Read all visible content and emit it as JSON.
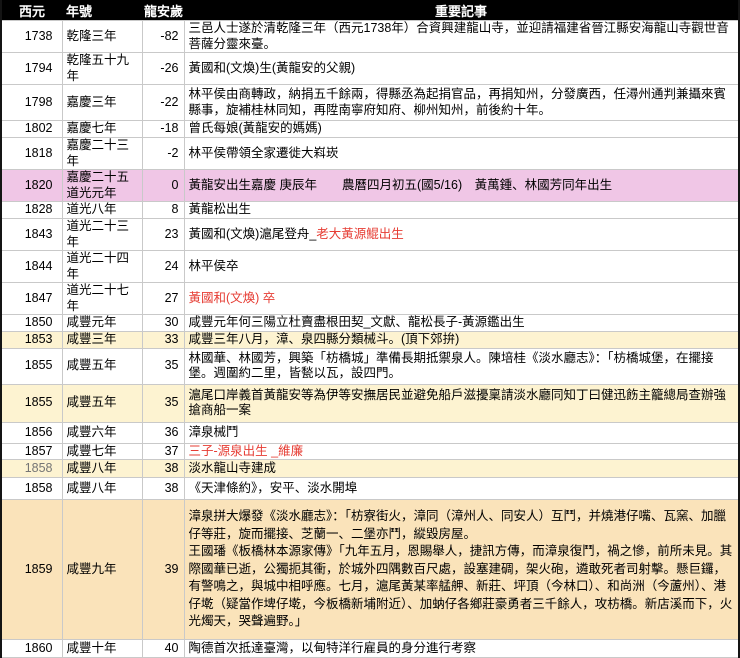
{
  "colors": {
    "header_bg": "#000000",
    "pink": "#f0c6e6",
    "yellow": "#fdf3d1",
    "tan": "#fae3ba",
    "red": "#e63c33"
  },
  "header": {
    "year": "西元",
    "era": "年號",
    "age": "龍安歲",
    "record": "重要記事"
  },
  "rows": [
    {
      "year": "1738",
      "era": "乾隆三年",
      "age": "-82",
      "record": "三邑人士遂於清乾隆三年（西元1738年）合資興建龍山寺，並迎請福建省晉江縣安海龍山寺觀世音菩薩分靈來臺。"
    },
    {
      "year": "1794",
      "era": "乾隆五十九年",
      "age": "-26",
      "record": "黃國和(文煥)生(黃龍安的父親)"
    },
    {
      "year": "1798",
      "era": "嘉慶三年",
      "age": "-22",
      "record": "林平侯由商轉政，納捐五千餘兩，得縣丞為起捐官品，再捐知州，分發廣西，任潯州通判兼攝來賓縣事，旋補桂林同知，再陞南寧府知府、柳州知州，前後約十年。"
    },
    {
      "year": "1802",
      "era": "嘉慶七年",
      "age": "-18",
      "record": "曾氏每娘(黃龍安的媽媽)"
    },
    {
      "year": "1818",
      "era": "嘉慶二十三年",
      "age": "-2",
      "record": "林平侯帶領全家遷徙大嵙崁"
    },
    {
      "year": "1820",
      "era": "嘉慶二十五",
      "era2": "道光元年",
      "age": "0",
      "record": "黃龍安出生嘉慶 庚辰年　　農曆四月初五(國5/16)　黃萬鍾、林國芳同年出生"
    },
    {
      "year": "1828",
      "era": "道光八年",
      "age": "8",
      "record": "黃龍松出生"
    },
    {
      "year": "1843",
      "era": "道光二十三年",
      "age": "23",
      "record": "黃國和(文煥)滬尾登舟_",
      "record_red": "老大黃源鯤出生"
    },
    {
      "year": "1844",
      "era": "道光二十四年",
      "age": "24",
      "record": "林平侯卒"
    },
    {
      "year": "1847",
      "era": "道光二十七年",
      "age": "27",
      "record": "黃國和(文煥) 卒"
    },
    {
      "year": "1850",
      "era": "咸豐元年",
      "age": "30",
      "record": "咸豐元年何三陽立杜賣盡根田契_文獻、龍松長子-黃源鑑出生"
    },
    {
      "year": "1853",
      "era": "咸豐三年",
      "age": "33",
      "record": "咸豐三年八月，漳、泉四縣分類械斗。(頂下郊拚)"
    },
    {
      "year": "1855",
      "era": "咸豐五年",
      "age": "35",
      "record": "林國華、林國芳，興築「枋橋城」準備長期抵禦泉人。陳培桂《淡水廳志》：「枋橋城堡，在擺接堡。週圍約二里，皆甃以瓦，設四門。"
    },
    {
      "year": "1855",
      "era": "咸豐五年",
      "age": "35",
      "record": "滬尾口岸義首黃龍安等為伊等安撫居民並避免船戶滋擾稟請淡水廳同知丁曰健迅飭主籠總局查辦強搶商船一案"
    },
    {
      "year": "1856",
      "era": "咸豐六年",
      "age": "36",
      "record": "漳泉械鬥"
    },
    {
      "year": "1857",
      "era": "咸豐七年",
      "age": "37",
      "record": "三子-源泉出生 _維廉"
    },
    {
      "year": "1858",
      "era": "咸豐八年",
      "age": "38",
      "record": "淡水龍山寺建成"
    },
    {
      "year": "1858",
      "era": "咸豐八年",
      "age": "38",
      "record": "《天津條約》，安平、淡水開埠"
    },
    {
      "year": "1859",
      "era": "咸豐九年",
      "age": "39",
      "record": "漳泉拼大爆發《淡水廳志》：「枋寮街火，漳同（漳州人、同安人）互鬥，并燒港仔嘴、瓦窯、加臘仔等莊，旋而擺接、芝蘭一、二堡亦鬥，縱毀房屋。",
      "record2": "王國璠《板橋林本源家傳》「九年五月，恩賜舉人，捷訊方傳，而漳泉復鬥，禍之慘，前所未見。其際國華已逝，公獨扼其衝，於城外四隅數百尺處，設塞建碉，架火砲，遴敢死者司射擊。懸巨鑼，有警鳴之，與城中相呼應。七月，滬尾黃某率艋舺、新莊、坪頂（今林口）、和尚洲（今蘆州）、港仔墘（疑當作埤仔墘，今板橋新埔附近）、加蚋仔各鄉莊豪勇者三千餘人，攻枋橋。新店溪而下，火光燭天，哭聲遍野。」"
    },
    {
      "year": "1860",
      "era": "咸豐十年",
      "age": "40",
      "record": "陶德首次抵達臺灣，以甸特洋行雇員的身分進行考察"
    }
  ]
}
